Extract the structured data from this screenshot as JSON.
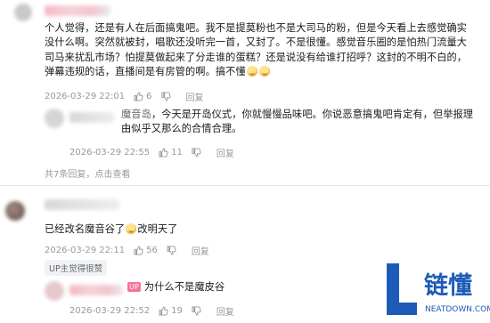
{
  "comments": [
    {
      "text": "个人觉得，还是有人在后面搞鬼吧。我不是提莫粉也不是大司马的粉，但是今天看上去感觉确实没什么啊。突然就被封，唱歌还没听完一首，又封了。不是很懂。感觉音乐圈的是怕热门流量大司马来扰乱市场？怕提莫做起来了分走谁的蛋糕？还是说没有给谁打招呼？这封的不明不白的，弹幕违规的话，直播间是有房管的啊。搞不懂",
      "date": "2026-03-29 22:01",
      "likes": "6",
      "reply_label": "回复",
      "sub_reply": {
        "name": "魔音岛",
        "text": "今天是开岛仪式，你就慢慢品味吧。你说恶意搞鬼吧肯定有，但举报理由似乎又那么的合情合理。",
        "date": "2026-03-29 22:55",
        "likes": "11",
        "reply_label": "回复"
      },
      "more": "共7条回复，点击查看"
    },
    {
      "text": "已经改名魔音谷了",
      "text_after": "改明天了",
      "date": "2026-03-29 22:11",
      "likes": "56",
      "reply_label": "回复",
      "tag": "UP主觉得很赞",
      "sub_reply": {
        "badge": "UP",
        "text": "为什么不是魔皮谷",
        "date": "2026-03-29 22:52",
        "likes": "19",
        "reply_label": "回复"
      }
    }
  ],
  "watermark": {
    "brand": "链懂",
    "domain": "NEATDOWN.COM",
    "color": "#1e5bb8"
  }
}
